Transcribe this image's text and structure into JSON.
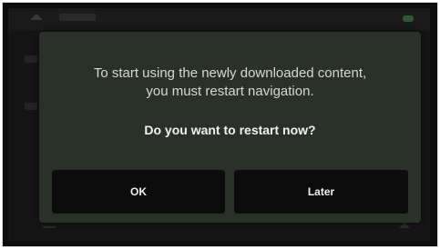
{
  "dialog": {
    "message_line1": "To start using the newly downloaded content,",
    "message_line2": "you must restart navigation.",
    "question": "Do you want to restart now?",
    "buttons": {
      "ok_label": "OK",
      "later_label": "Later"
    }
  },
  "background": {
    "icons": [
      "up-arrow-icon",
      "signal-icon"
    ]
  },
  "colors": {
    "dialog_bg": "#2a3128",
    "button_bg": "#0c0c0c",
    "text": "#d6d9d2"
  }
}
